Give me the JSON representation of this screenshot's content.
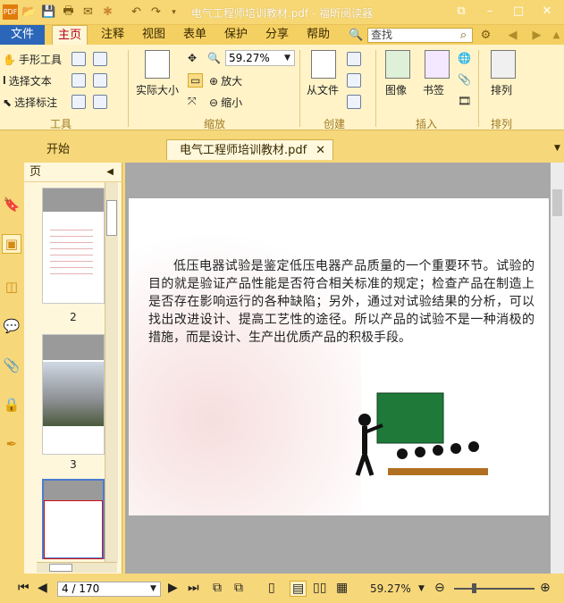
{
  "window": {
    "title": "电气工程师培训教材.pdf - 福昕阅读器"
  },
  "menubar": {
    "file": "文件",
    "items": [
      "主页",
      "注释",
      "视图",
      "表单",
      "保护",
      "分享",
      "帮助"
    ],
    "search_placeholder": "查找"
  },
  "ribbon": {
    "hand_tool": "手形工具",
    "select_text": "选择文本",
    "select_annotation": "选择标注",
    "actual_size": "实际大小",
    "zoom_value": "59.27%",
    "zoom_in": "放大",
    "zoom_out": "缩小",
    "from_file": "从文件",
    "image": "图像",
    "bookmark": "书签",
    "arrange": "排列",
    "groups": {
      "tools": "工具",
      "zoom": "缩放",
      "create": "创建",
      "insert": "插入",
      "arrange": "排列"
    }
  },
  "tabs": {
    "start": "开始",
    "document": "电气工程师培训教材.pdf"
  },
  "panel": {
    "title": "页",
    "pages": [
      "2",
      "3"
    ]
  },
  "document": {
    "paragraph": "低压电器试验是鉴定低压电器产品质量的一个重要环节。试验的目的就是验证产品性能是否符合相关标准的规定；检查产品在制造上是否存在影响运行的各种缺陷；另外，通过对试验结果的分析，可以找出改进设计、提高工艺性的途径。所以产品的试验不是一种消极的措施，而是设计、生产出优质产品的积极手段。"
  },
  "status": {
    "page_field": "4 / 170",
    "zoom": "59.27%"
  },
  "colors": {
    "accent": "#f6d77a",
    "file_tab": "#2b66b8",
    "active_text": "#b4001b"
  }
}
